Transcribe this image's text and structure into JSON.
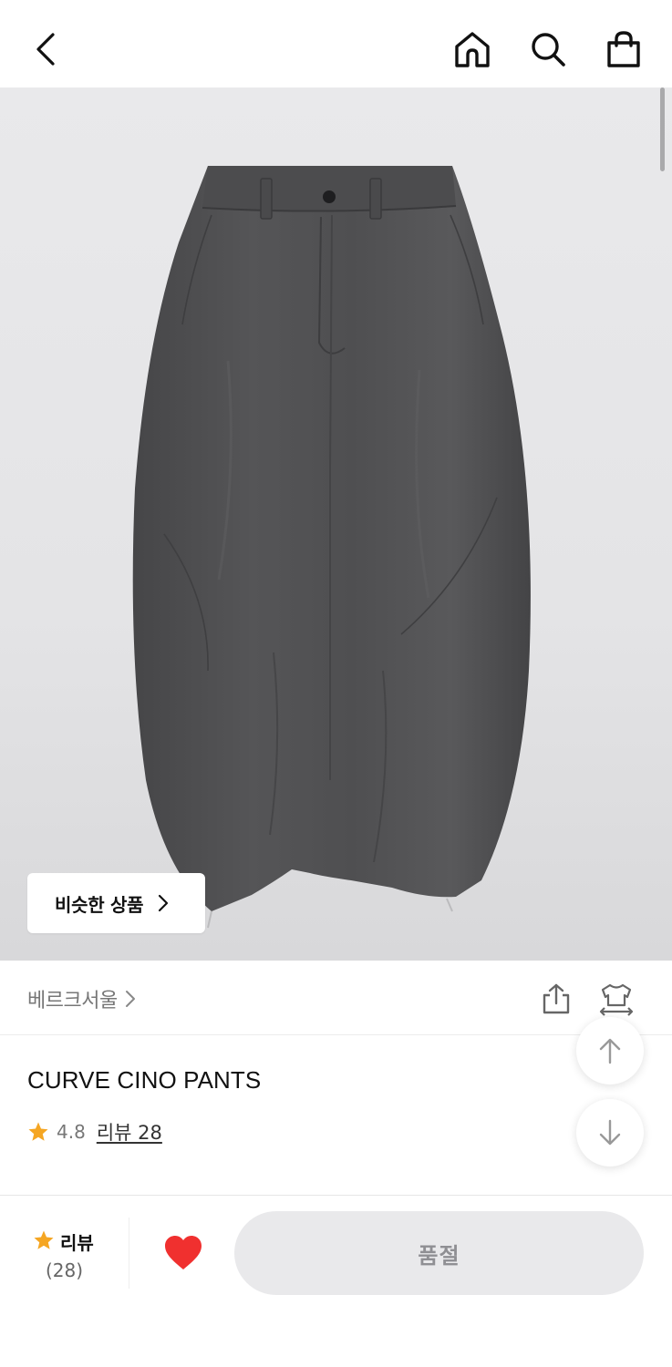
{
  "header": {
    "back_icon": "chevron-left-icon",
    "home_icon": "home-icon",
    "search_icon": "search-icon",
    "cart_icon": "shopping-bag-icon"
  },
  "hero": {
    "product_image": "dark gray curved wide-leg pants",
    "similar_button_label": "비슷한 상품"
  },
  "brand": {
    "name": "베르크서울",
    "share_icon": "share-icon",
    "fit_icon": "size-fit-icon"
  },
  "product": {
    "name": "CURVE CINO PANTS",
    "rating": "4.8",
    "review_link": "리뷰 28"
  },
  "floating": {
    "up_icon": "arrow-up-icon",
    "down_icon": "arrow-down-icon"
  },
  "bottom_bar": {
    "review_label": "리뷰",
    "review_count": "(28)",
    "status_label": "품절"
  },
  "colors": {
    "star": "#F5A623",
    "heart": "#F0302F",
    "soldout_bg": "#E9E9EB",
    "soldout_text": "#8F8F93"
  }
}
